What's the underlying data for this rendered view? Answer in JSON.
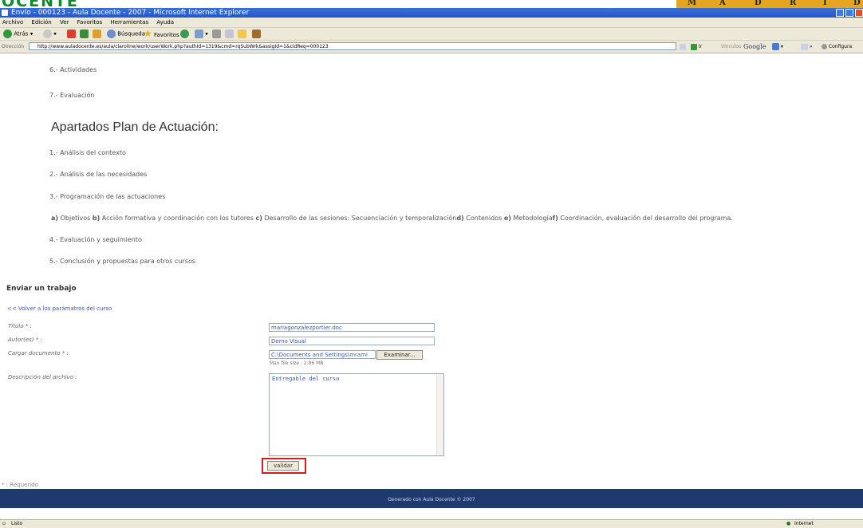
{
  "window": {
    "title": "Envío - 000123 - Aula Docente - 2007 - Microsoft Internet Explorer",
    "brand_logo": "OCENTE",
    "brand_city": [
      "M",
      "A",
      "D",
      "R",
      "I",
      "D"
    ]
  },
  "menu": [
    "Archivo",
    "Edición",
    "Ver",
    "Favoritos",
    "Herramientas",
    "Ayuda"
  ],
  "toolbar": {
    "back": "Atrás",
    "search": "Búsqueda",
    "favorites": "Favoritos"
  },
  "address": {
    "label": "Dirección",
    "url": "http://www.auladocente.es/aula/claroline/work/userWork.php?authId=1319&cmd=rqSubWrk&assigId=1&cidReq=000123",
    "go": "Ir",
    "links": "Vínculos",
    "google": "Google",
    "configure": "Configura"
  },
  "content": {
    "top_items": [
      "6.- Actividades",
      "7.- Evaluación"
    ],
    "plan_title": "Apartados Plan de Actuación:",
    "plan_items": [
      "1.- Análisis del contexto",
      "2.- Análisis de las necesidades",
      "3.- Programación de las actuaciones"
    ],
    "sub_items": [
      {
        "letter": "a)",
        "text": "Objetivos"
      },
      {
        "letter": "b)",
        "text": "Acción formativa y coordinación con los tutores"
      },
      {
        "letter": "c)",
        "text": "Desarrollo de las sesiones: Secuenciación y temporalización"
      },
      {
        "letter": "d)",
        "text": "Contenidos"
      },
      {
        "letter": "e)",
        "text": "Metodología"
      },
      {
        "letter": "f)",
        "text": "Coordinación, evaluación del desarrollo del programa."
      }
    ],
    "plan_items_after": [
      "4.- Evaluación y seguimiento",
      "5.- Conclusión y propuestas para otros cursos"
    ]
  },
  "form": {
    "heading": "Enviar un trabajo",
    "back_link": "<< Volver a los parámatros del curso",
    "title_label": "Título * :",
    "title_value": "mariagonzalezportier.doc",
    "author_label": "Autor(es) * :",
    "author_value": "Demo Visual",
    "upload_label": "Cargar documento * :",
    "upload_value": "C:\\Documents and Settings\\mrami",
    "browse_button": "Examinar...",
    "max_size": "Max file size : 2.86 MB",
    "description_label": "Descripción del archivo :",
    "description_value": "Entregable del curso",
    "submit_button": "validar",
    "required_note": "* : Requerido"
  },
  "footer": {
    "text": "Generado con Aula Docente © 2007"
  },
  "status": {
    "left": "Listo",
    "zone": "Internet"
  }
}
